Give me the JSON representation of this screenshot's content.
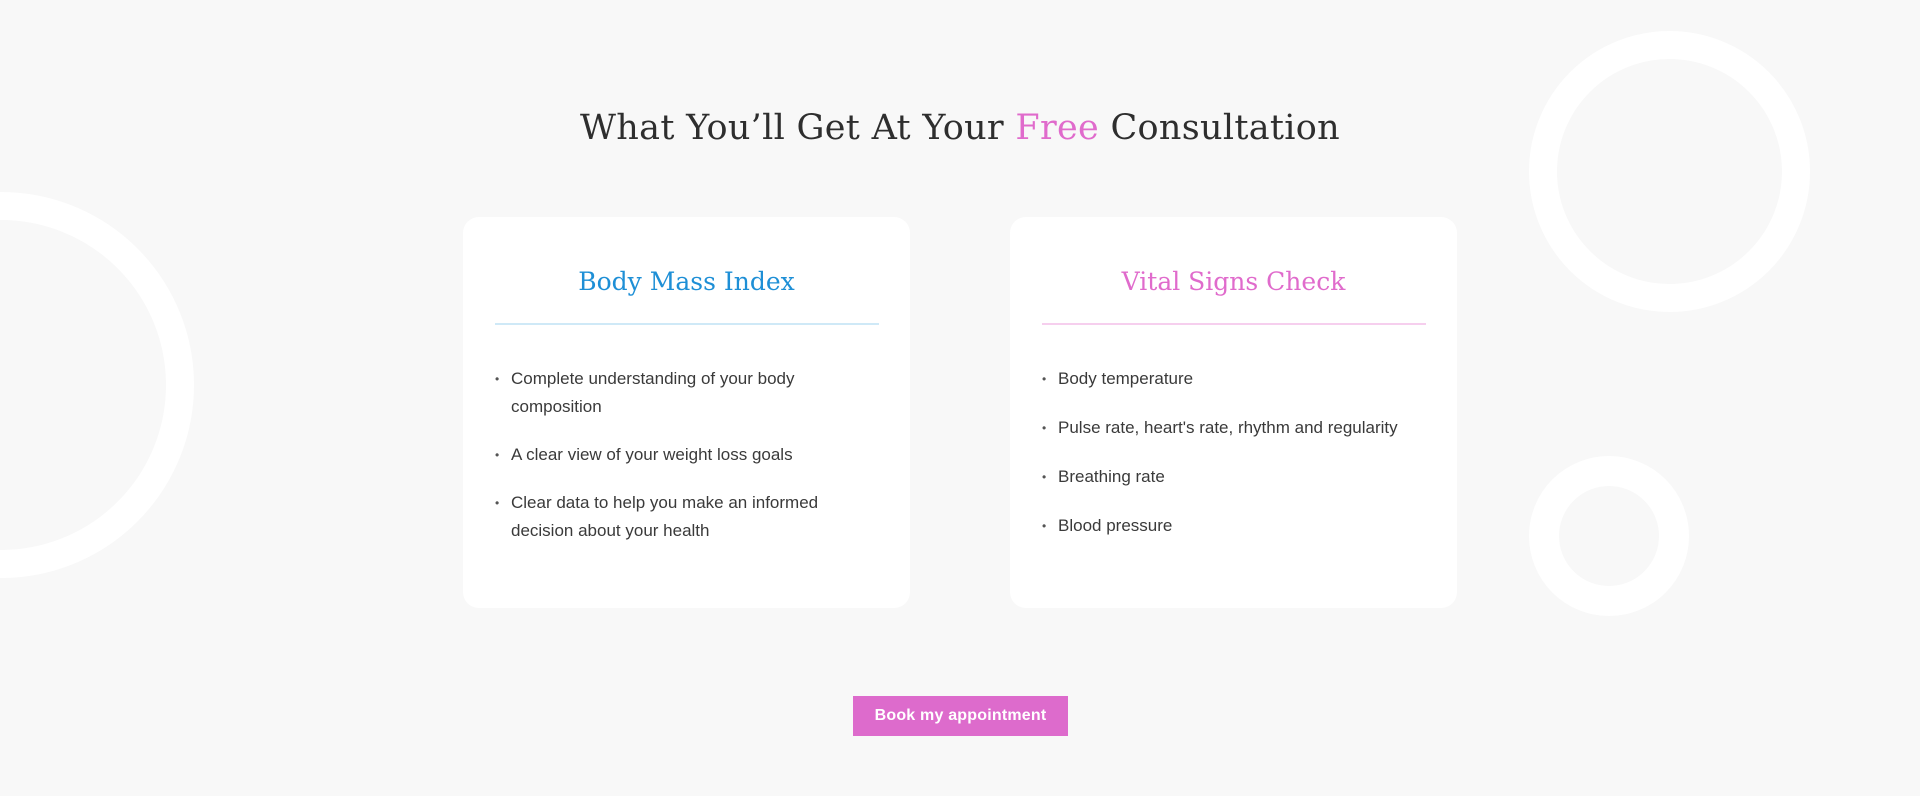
{
  "section": {
    "heading_before": "What You’ll Get At Your ",
    "heading_accent": "Free",
    "heading_after": " Consultation",
    "accent_color": "#e06bcc"
  },
  "cards": [
    {
      "title": "Body Mass Index",
      "title_color": "#1e8fd6",
      "items": [
        "Complete understanding of your body composition",
        "A clear view of your weight loss goals",
        "Clear data to help you make an informed decision about your health"
      ]
    },
    {
      "title": "Vital Signs Check",
      "title_color": "#e06bcc",
      "items": [
        "Body temperature",
        "Pulse rate, heart's rate, rhythm and regularity",
        "Breathing rate",
        "Blood pressure"
      ]
    }
  ],
  "bullet_glyph": "•",
  "cta": {
    "label": "Book my appointment",
    "color": "#dd6bcc"
  }
}
